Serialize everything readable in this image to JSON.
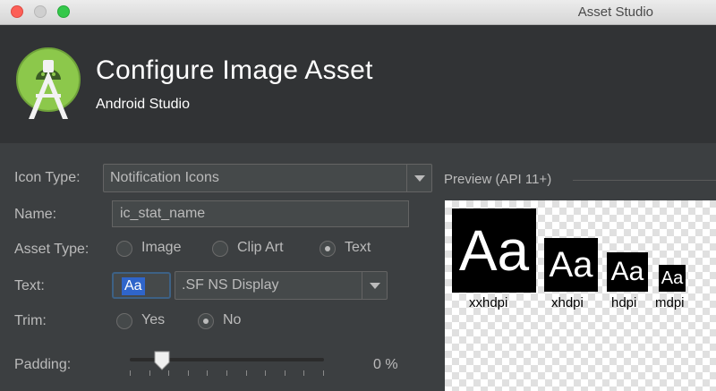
{
  "window": {
    "title": "Asset Studio"
  },
  "header": {
    "title": "Configure Image Asset",
    "subtitle": "Android Studio",
    "logo_icon": "android-studio-logo"
  },
  "form": {
    "icon_type": {
      "label": "Icon Type:",
      "value": "Notification Icons"
    },
    "name": {
      "label": "Name:",
      "value": "ic_stat_name"
    },
    "asset_type": {
      "label": "Asset Type:",
      "options": [
        "Image",
        "Clip Art",
        "Text"
      ],
      "selected": "Text"
    },
    "text": {
      "label": "Text:",
      "value": "Aa",
      "font": ".SF NS Display"
    },
    "trim": {
      "label": "Trim:",
      "options": [
        "Yes",
        "No"
      ],
      "selected": "No"
    },
    "padding": {
      "label": "Padding:",
      "value": "0 %",
      "slider_fraction": 0.0
    }
  },
  "preview": {
    "label": "Preview (API 11+)",
    "sample_text": "Aa",
    "densities": [
      "xxhdpi",
      "xhdpi",
      "hdpi",
      "mdpi"
    ]
  },
  "colors": {
    "background": "#3c3f41",
    "header": "#313335",
    "accent_selection": "#2f65ca",
    "logo_green": "#8cc84b"
  }
}
